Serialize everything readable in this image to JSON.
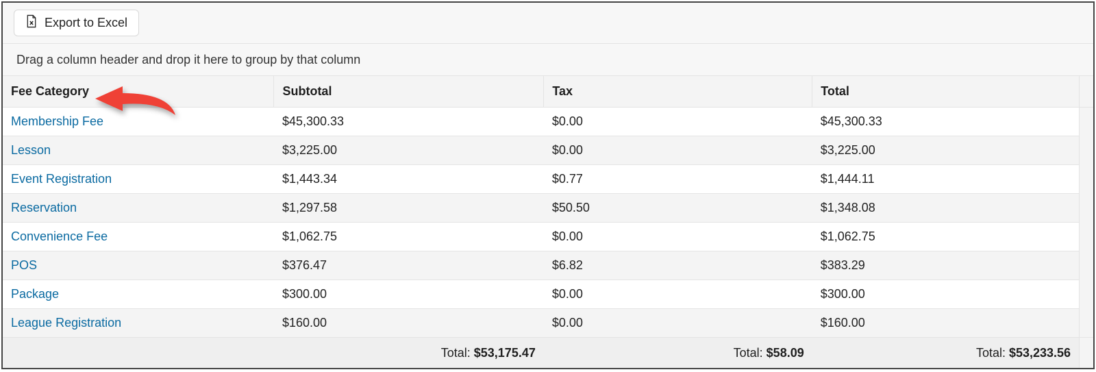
{
  "toolbar": {
    "export_label": "Export to Excel"
  },
  "group_hint": "Drag a column header and drop it here to group by that column",
  "columns": {
    "category": "Fee Category",
    "subtotal": "Subtotal",
    "tax": "Tax",
    "total": "Total"
  },
  "rows": [
    {
      "category": "Membership Fee",
      "subtotal": "$45,300.33",
      "tax": "$0.00",
      "total": "$45,300.33"
    },
    {
      "category": "Lesson",
      "subtotal": "$3,225.00",
      "tax": "$0.00",
      "total": "$3,225.00"
    },
    {
      "category": "Event Registration",
      "subtotal": "$1,443.34",
      "tax": "$0.77",
      "total": "$1,444.11"
    },
    {
      "category": "Reservation",
      "subtotal": "$1,297.58",
      "tax": "$50.50",
      "total": "$1,348.08"
    },
    {
      "category": "Convenience Fee",
      "subtotal": "$1,062.75",
      "tax": "$0.00",
      "total": "$1,062.75"
    },
    {
      "category": "POS",
      "subtotal": "$376.47",
      "tax": "$6.82",
      "total": "$383.29"
    },
    {
      "category": "Package",
      "subtotal": "$300.00",
      "tax": "$0.00",
      "total": "$300.00"
    },
    {
      "category": "League Registration",
      "subtotal": "$160.00",
      "tax": "$0.00",
      "total": "$160.00"
    }
  ],
  "footer": {
    "label": "Total: ",
    "subtotal": "$53,175.47",
    "tax": "$58.09",
    "total": "$53,233.56"
  },
  "chart_data": {
    "type": "table",
    "columns": [
      "Fee Category",
      "Subtotal",
      "Tax",
      "Total"
    ],
    "rows": [
      [
        "Membership Fee",
        45300.33,
        0.0,
        45300.33
      ],
      [
        "Lesson",
        3225.0,
        0.0,
        3225.0
      ],
      [
        "Event Registration",
        1443.34,
        0.77,
        1444.11
      ],
      [
        "Reservation",
        1297.58,
        50.5,
        1348.08
      ],
      [
        "Convenience Fee",
        1062.75,
        0.0,
        1062.75
      ],
      [
        "POS",
        376.47,
        6.82,
        383.29
      ],
      [
        "Package",
        300.0,
        0.0,
        300.0
      ],
      [
        "League Registration",
        160.0,
        0.0,
        160.0
      ]
    ],
    "totals": {
      "Subtotal": 53175.47,
      "Tax": 58.09,
      "Total": 53233.56
    }
  }
}
